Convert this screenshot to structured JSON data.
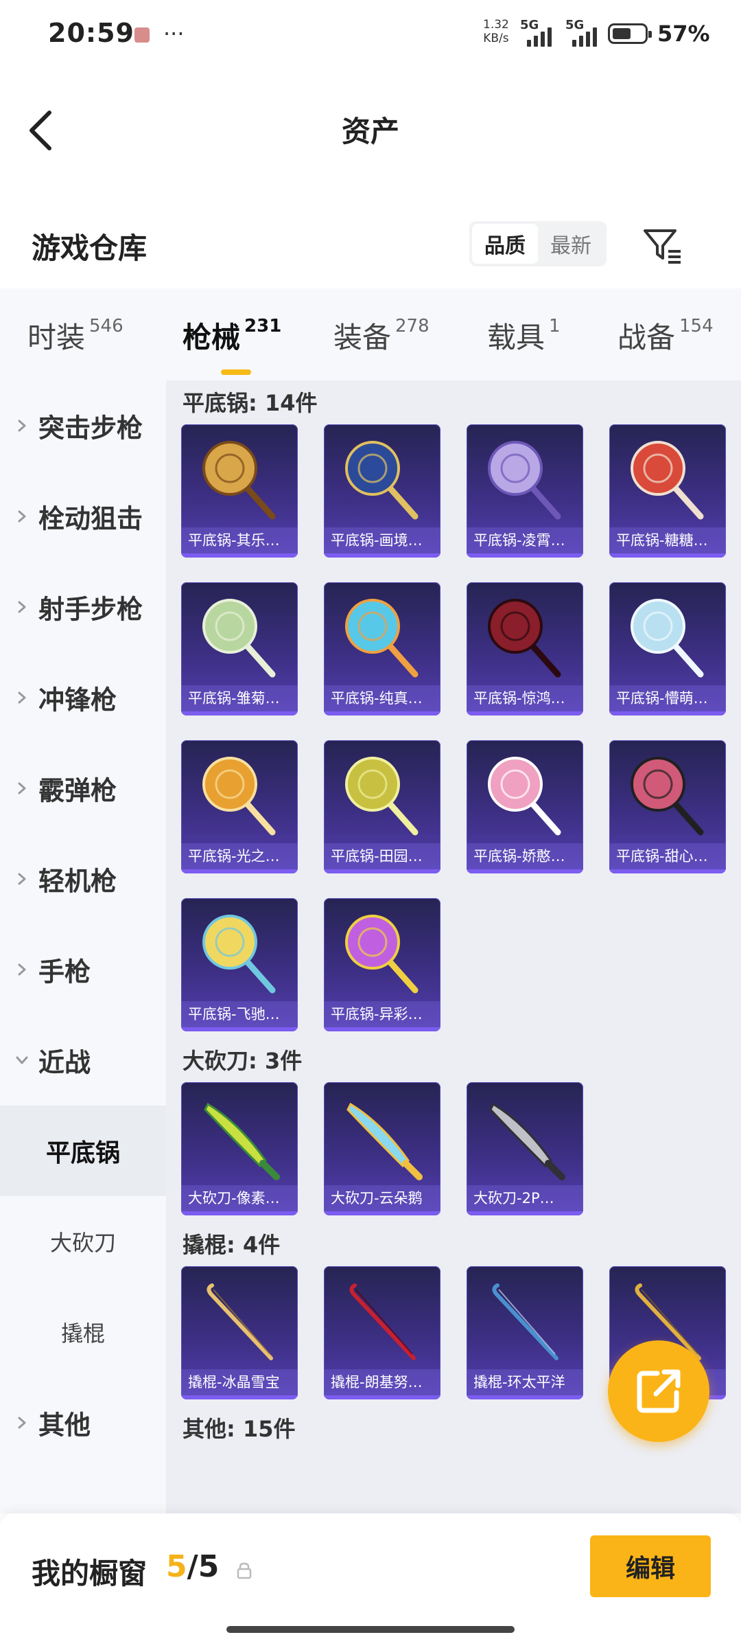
{
  "status_bar": {
    "time": "20:59",
    "dots": "···",
    "net_speed_value": "1.32",
    "net_speed_unit": "KB/s",
    "sim1": "5G",
    "sim2": "5G",
    "battery_pct": "57%",
    "battery_level": 0.57
  },
  "header": {
    "title": "资产"
  },
  "section": {
    "title": "游戏仓库"
  },
  "sort": {
    "options": [
      {
        "label": "品质",
        "active": true
      },
      {
        "label": "最新",
        "active": false
      }
    ]
  },
  "tabs": [
    {
      "label": "时装",
      "count": "546"
    },
    {
      "label": "枪械",
      "count": "231",
      "active": true
    },
    {
      "label": "装备",
      "count": "278"
    },
    {
      "label": "载具",
      "count": "1"
    },
    {
      "label": "战备",
      "count": "154"
    }
  ],
  "sidebar": {
    "categories": [
      "突击步枪",
      "栓动狙击",
      "射手步枪",
      "冲锋枪",
      "霰弹枪",
      "轻机枪",
      "手枪",
      "近战"
    ],
    "subcategories": [
      "平底锅",
      "大砍刀",
      "撬棍"
    ],
    "active_sub": "平底锅",
    "other": "其他"
  },
  "groups": [
    {
      "title": "平底锅: 14件",
      "items": [
        {
          "name": "平底锅-其乐…"
        },
        {
          "name": "平底锅-画境…"
        },
        {
          "name": "平底锅-凌霄…"
        },
        {
          "name": "平底锅-糖糖…"
        },
        {
          "name": "平底锅-雏菊…"
        },
        {
          "name": "平底锅-纯真…"
        },
        {
          "name": "平底锅-惊鸿…"
        },
        {
          "name": "平底锅-懵萌…"
        },
        {
          "name": "平底锅-光之…"
        },
        {
          "name": "平底锅-田园…"
        },
        {
          "name": "平底锅-娇憨…"
        },
        {
          "name": "平底锅-甜心…"
        },
        {
          "name": "平底锅-飞驰…"
        },
        {
          "name": "平底锅-异彩…"
        }
      ]
    },
    {
      "title": "大砍刀: 3件",
      "items": [
        {
          "name": "大砍刀-像素…"
        },
        {
          "name": "大砍刀-云朵鹅"
        },
        {
          "name": "大砍刀-2P…"
        }
      ]
    },
    {
      "title": "撬棍: 4件",
      "items": [
        {
          "name": "撬棍-冰晶雪宝"
        },
        {
          "name": "撬棍-朗基努…"
        },
        {
          "name": "撬棍-环太平洋"
        },
        {
          "name": "…"
        }
      ]
    },
    {
      "title": "其他: 15件",
      "items": []
    }
  ],
  "showcase": {
    "label": "我的橱窗",
    "current": "5",
    "total": "/5",
    "edit_label": "编辑"
  },
  "colors": {
    "accent": "#fbb417",
    "card_bg": "#3d2f84",
    "card_edge": "#7c5cf0",
    "content_bg": "#eceef4",
    "sidebar_bg": "#f6f8fb"
  }
}
